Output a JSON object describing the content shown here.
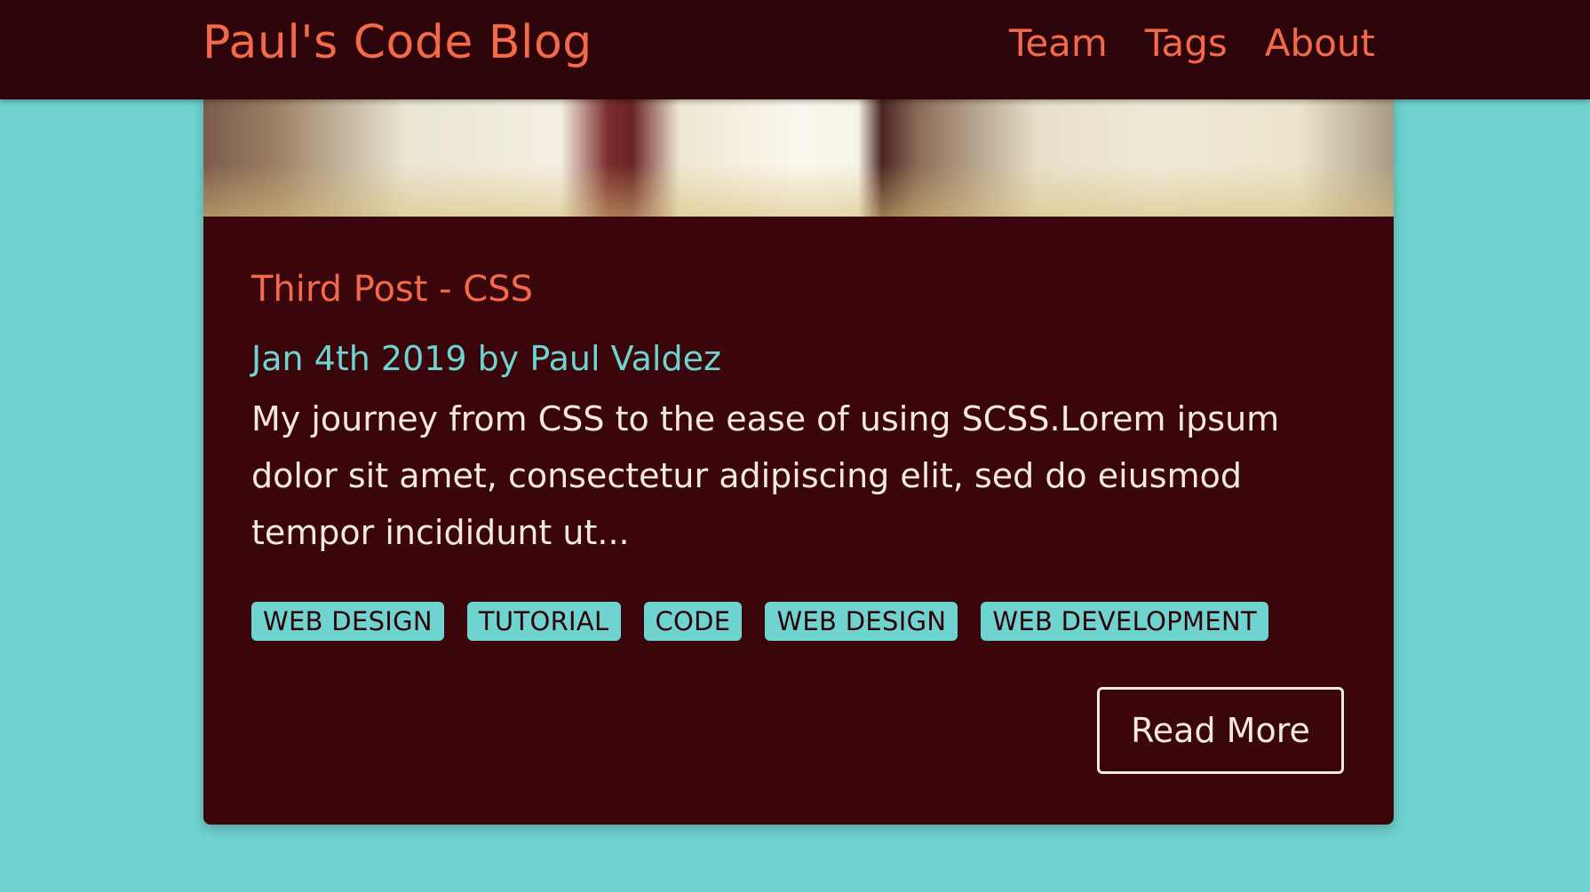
{
  "header": {
    "brand": "Paul's Code Blog",
    "nav": [
      {
        "label": "Team"
      },
      {
        "label": "Tags"
      },
      {
        "label": "About"
      }
    ]
  },
  "post": {
    "title": "Third Post - CSS",
    "meta": "Jan 4th 2019 by Paul Valdez",
    "excerpt": "My journey from CSS to the ease of using SCSS.Lorem ipsum dolor sit amet, consectetur adipiscing elit, sed do eiusmod tempor incididunt ut...",
    "tags": [
      "WEB DESIGN",
      "TUTORIAL",
      "CODE",
      "WEB DESIGN",
      "WEB DEVELOPMENT"
    ],
    "read_more_label": "Read More"
  },
  "colors": {
    "header_bg": "#2c0409",
    "card_bg": "#3a060b",
    "accent_orange": "#f26a4a",
    "accent_teal": "#6fd3cf",
    "text_light": "#f5e8dc"
  }
}
